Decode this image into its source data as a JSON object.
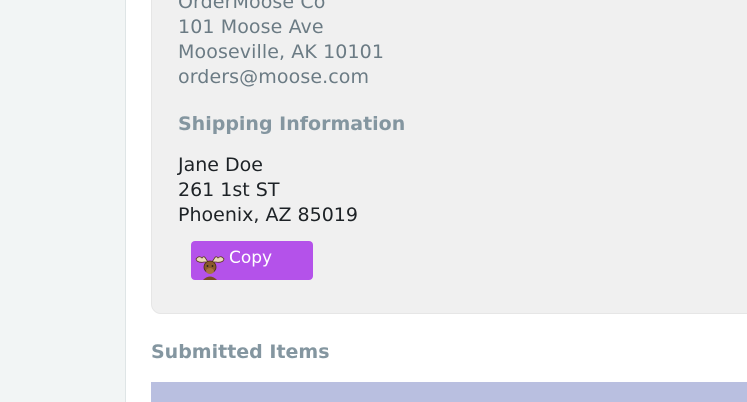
{
  "vendor": {
    "name": "OrderMoose Co",
    "street": "101 Moose Ave",
    "city_state_zip": "Mooseville, AK 10101",
    "email": "orders@moose.com"
  },
  "shipping": {
    "heading": "Shipping Information",
    "name": "Jane Doe",
    "street": "261 1st ST",
    "city_state_zip": "Phoenix, AZ 85019"
  },
  "copy_button": {
    "label": "Copy",
    "icon": "moose-icon",
    "color": "#b452ea"
  },
  "submitted_items": {
    "heading": "Submitted Items",
    "header_color": "#b9bfe0"
  }
}
